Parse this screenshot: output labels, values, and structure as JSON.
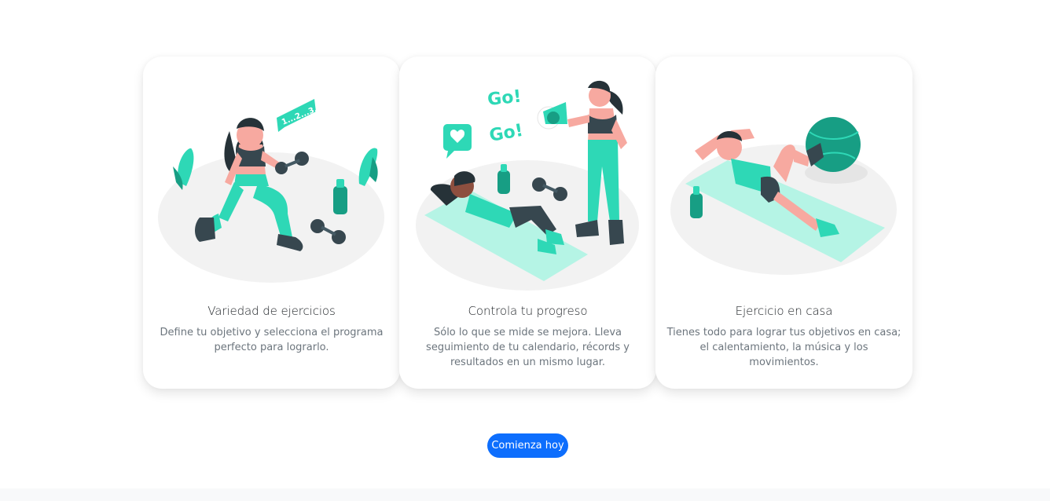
{
  "features": [
    {
      "title": "Variedad de ejercicios",
      "text": "Define tu objetivo y selecciona el programa perfecto para lograrlo.",
      "illustration": "woman-lunge-dumbbell",
      "counter_text": "1...2...3..."
    },
    {
      "title": "Controla tu progreso",
      "text": "Sólo lo que se mide se mejora. Lleva seguimiento de tu calendario, récords y resultados en un mismo lugar.",
      "illustration": "coach-megaphone-situps",
      "go_text": "Go!"
    },
    {
      "title": "Ejercicio en casa",
      "text": "Tienes todo para lograr tus objetivos en casa; el calentamiento, la música y los movimientos.",
      "illustration": "man-crunches-ball"
    }
  ],
  "cta": {
    "label": "Comienza hoy"
  },
  "colors": {
    "accent": "#2ed8b6",
    "accent_dark": "#179e84",
    "primary_button": "#0d6efd",
    "skin": "#f7a9a0",
    "hair": "#263238",
    "shadow": "#f2f2f2"
  }
}
